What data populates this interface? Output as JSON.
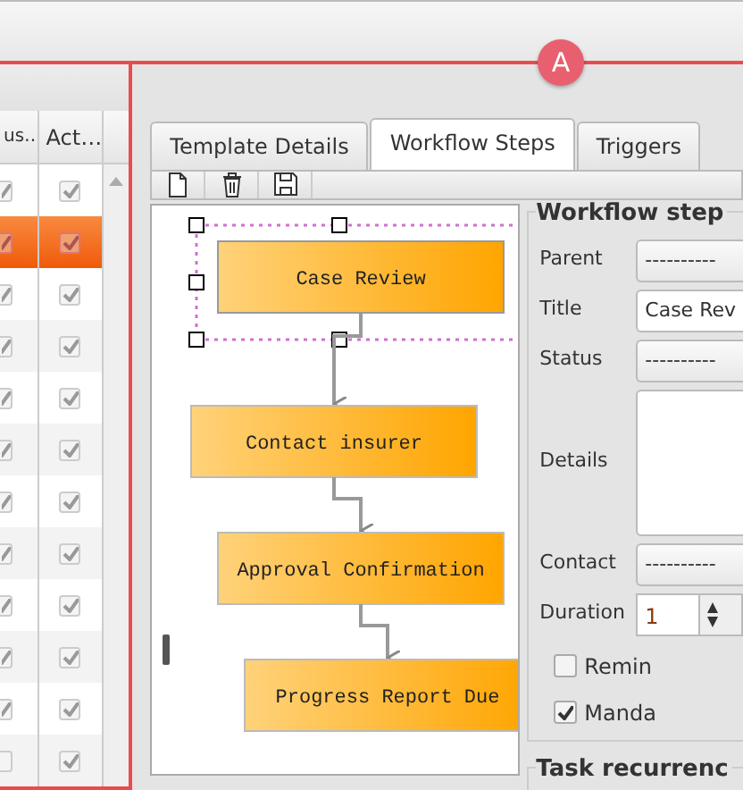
{
  "marker": {
    "label": "A"
  },
  "grid": {
    "columns": [
      "us…",
      "Act…"
    ],
    "rows": [
      {
        "col1": true,
        "active": true,
        "selected": false
      },
      {
        "col1": true,
        "active": true,
        "selected": true
      },
      {
        "col1": true,
        "active": true,
        "selected": false
      },
      {
        "col1": true,
        "active": true,
        "selected": false
      },
      {
        "col1": true,
        "active": true,
        "selected": false
      },
      {
        "col1": true,
        "active": true,
        "selected": false
      },
      {
        "col1": true,
        "active": true,
        "selected": false
      },
      {
        "col1": true,
        "active": true,
        "selected": false
      },
      {
        "col1": true,
        "active": true,
        "selected": false
      },
      {
        "col1": true,
        "active": true,
        "selected": false
      },
      {
        "col1": true,
        "active": true,
        "selected": false
      },
      {
        "col1": false,
        "active": true,
        "selected": false
      }
    ]
  },
  "tabs": [
    {
      "label": "Template Details",
      "selected": false
    },
    {
      "label": "Workflow Steps",
      "selected": true
    },
    {
      "label": "Triggers",
      "selected": false
    }
  ],
  "toolbar": [
    {
      "kind": "new"
    },
    {
      "kind": "delete"
    },
    {
      "kind": "save"
    }
  ],
  "steps": [
    {
      "title": "Case Review",
      "selected": true
    },
    {
      "title": "Contact insurer",
      "selected": false
    },
    {
      "title": "Approval Confirmation",
      "selected": false
    },
    {
      "title": "Progress Report Due",
      "selected": false
    }
  ],
  "form": {
    "legend": "Workflow step",
    "fields": [
      {
        "kind": "select",
        "label": "Parent",
        "value": "----------"
      },
      {
        "kind": "text",
        "label": "Title",
        "value": "Case Rev"
      },
      {
        "kind": "select",
        "label": "Status",
        "value": "----------"
      },
      {
        "kind": "textarea",
        "label": "Details"
      },
      {
        "kind": "select",
        "label": "Contact",
        "value": "----------"
      },
      {
        "kind": "spinner",
        "label": "Duration",
        "value": "1"
      },
      {
        "kind": "checkbox",
        "label": "Remin",
        "checked": false
      },
      {
        "kind": "checkbox",
        "label": "Manda",
        "checked": true
      }
    ],
    "next_legend": "Task recurrenc"
  }
}
